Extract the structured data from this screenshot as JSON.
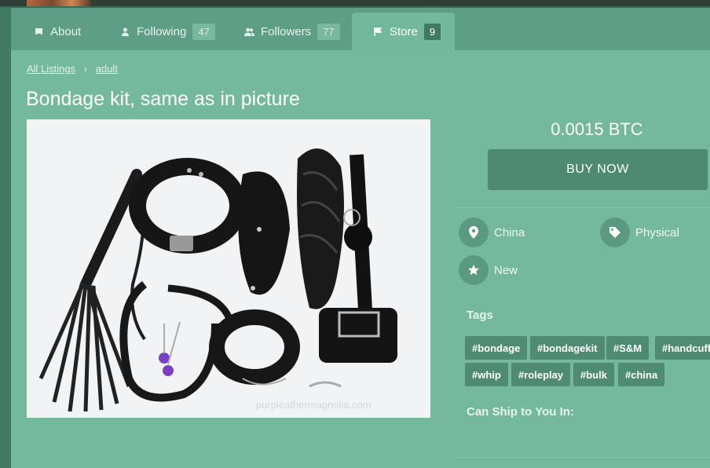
{
  "tabs": [
    {
      "label": "About",
      "icon": "book-icon"
    },
    {
      "label": "Following",
      "count": "47",
      "icon": "user-icon"
    },
    {
      "label": "Followers",
      "count": "77",
      "icon": "users-icon"
    },
    {
      "label": "Store",
      "count": "9",
      "icon": "flag-icon",
      "active": true
    }
  ],
  "breadcrumb": {
    "root": "All Listings",
    "separator": "›",
    "category": "adult"
  },
  "listing": {
    "title": "Bondage kit, same as in picture",
    "price": "0.0015 BTC",
    "buy_label": "BUY NOW",
    "location": "China",
    "type": "Physical",
    "condition": "New",
    "image_watermark": "purpleathermagnolia.com"
  },
  "tags_label": "Tags",
  "tags": [
    "#bondage",
    "#bondagekit",
    "#S&M",
    "#handcuff",
    "#whip",
    "#roleplay",
    "#bulk",
    "#china"
  ],
  "ship_label": "Can Ship to You In:",
  "colors": {
    "accent": "#74b89e",
    "button": "#4e8a72",
    "tab_bar": "#5f9e86"
  }
}
